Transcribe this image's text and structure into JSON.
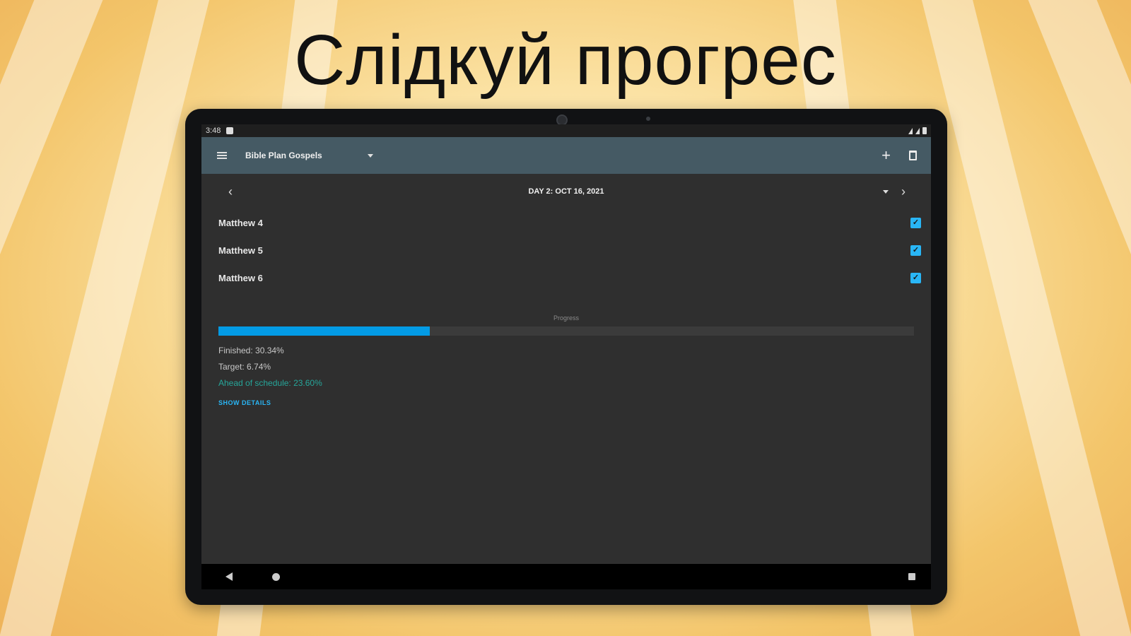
{
  "headline": "Слідкуй прогрес",
  "statusbar": {
    "time": "3:48"
  },
  "toolbar": {
    "plan_title": "Bible Plan Gospels",
    "add_label": "+"
  },
  "day_nav": {
    "prev": "‹",
    "label": "DAY 2: OCT 16, 2021",
    "next": "›"
  },
  "readings": [
    {
      "name": "Matthew 4",
      "checked": true
    },
    {
      "name": "Matthew 5",
      "checked": true
    },
    {
      "name": "Matthew 6",
      "checked": true
    }
  ],
  "progress": {
    "label": "Progress",
    "fraction": 0.3034,
    "finished": "Finished: 30.34%",
    "target": "Target: 6.74%",
    "ahead": "Ahead of schedule: 23.60%",
    "show_details": "SHOW DETAILS"
  },
  "colors": {
    "accent": "#29b6f6",
    "toolbar": "#455a64",
    "ahead": "#26a69a",
    "progress_fill": "#039be5"
  },
  "icons": {
    "menu": "menu-icon",
    "dropdown": "chevron-down-icon",
    "add": "plus-icon",
    "delete": "trash-icon",
    "checkbox": "checkbox-checked-icon"
  }
}
